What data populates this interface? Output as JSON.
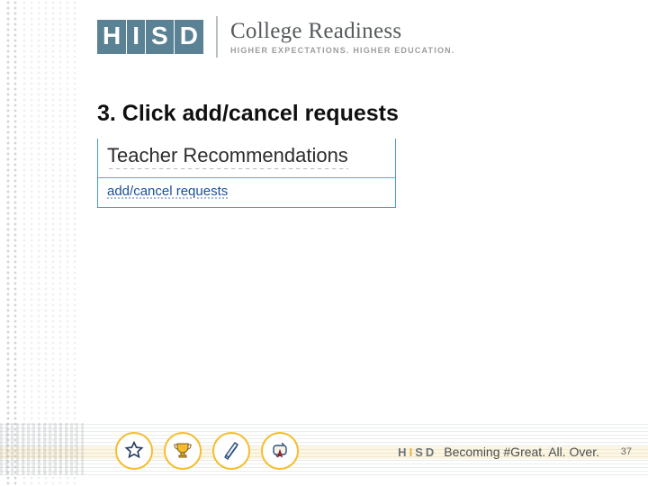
{
  "brand": {
    "letters": [
      "H",
      "I",
      "S",
      "D"
    ],
    "title": "College Readiness",
    "tagline": "HIGHER EXPECTATIONS. HIGHER EDUCATION."
  },
  "heading": "3.  Click add/cancel requests",
  "panel": {
    "title": "Teacher Recommendations",
    "link": "add/cancel requests"
  },
  "footer": {
    "hisd": "HISD",
    "slogan": "Becoming #Great. All. Over.",
    "page": "37"
  },
  "icons": {
    "star": "star-icon",
    "trophy": "trophy-icon",
    "pencils": "pencils-icon",
    "scroll": "scroll-icon"
  }
}
